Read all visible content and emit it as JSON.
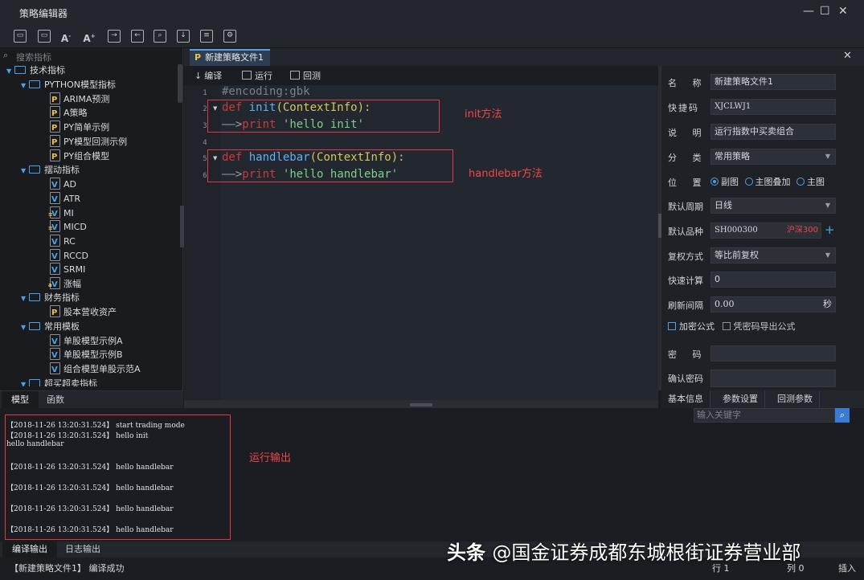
{
  "window": {
    "title": "策略编辑器",
    "minimize": "—",
    "maximize": "☐",
    "close": "✕"
  },
  "toolbar": {
    "font_decrease": "A",
    "font_increase": "A"
  },
  "left_panel": {
    "search_placeholder": "搜索指标",
    "tree": [
      {
        "label": "技术指标",
        "type": "folder"
      },
      {
        "label": "PYTHON模型指标",
        "type": "folder"
      },
      {
        "label": "ARIMA预测",
        "type": "py"
      },
      {
        "label": "A策略",
        "type": "py"
      },
      {
        "label": "PY简单示例",
        "type": "py"
      },
      {
        "label": "PY模型回测示例",
        "type": "py"
      },
      {
        "label": "PY组合模型",
        "type": "py"
      },
      {
        "label": "摆动指标",
        "type": "folder"
      },
      {
        "label": "AD",
        "type": "v"
      },
      {
        "label": "ATR",
        "type": "v"
      },
      {
        "label": "MI",
        "type": "v"
      },
      {
        "label": "MICD",
        "type": "v"
      },
      {
        "label": "RC",
        "type": "v"
      },
      {
        "label": "RCCD",
        "type": "v"
      },
      {
        "label": "SRMI",
        "type": "v"
      },
      {
        "label": "涨幅",
        "type": "v"
      },
      {
        "label": "财务指标",
        "type": "folder"
      },
      {
        "label": "股本营收资产",
        "type": "py"
      },
      {
        "label": "常用模板",
        "type": "folder"
      },
      {
        "label": "单股模型示例A",
        "type": "v"
      },
      {
        "label": "单股模型示例B",
        "type": "v"
      },
      {
        "label": "组合模型单股示范A",
        "type": "v"
      },
      {
        "label": "超买超卖指标",
        "type": "folder"
      }
    ],
    "tabs": [
      "模型",
      "函数"
    ]
  },
  "editor": {
    "file_tab": "新建策略文件1",
    "file_tab_icon": "P",
    "close": "✕",
    "actions": {
      "compile": "编译",
      "run": "运行",
      "backtest": "回测"
    },
    "line_numbers": [
      "1",
      "2",
      "3",
      "4",
      "5",
      "6"
    ],
    "code": {
      "l1": "#encoding:gbk",
      "l2_kw": "def",
      "l2_fn": "init",
      "l2_rest": "(ContextInfo):",
      "l3_arrow": "——>",
      "l3_kw": "print",
      "l3_str": "'hello init'",
      "l5_kw": "def",
      "l5_fn": "handlebar",
      "l5_rest": "(ContextInfo):",
      "l6_arrow": "——>",
      "l6_kw": "print",
      "l6_str": "'hello handlebar'"
    },
    "annotations": {
      "init": "init方法",
      "handlebar": "handlebar方法"
    }
  },
  "properties": {
    "name_label": "名 称",
    "name_value": "新建策略文件1",
    "shortcut_label": "快捷码",
    "shortcut_value": "XJCLWJ1",
    "desc_label": "说 明",
    "desc_value": "运行指数中买卖组合",
    "category_label": "分 类",
    "category_value": "常用策略",
    "position_label": "位 置",
    "position_options": [
      "副图",
      "主图叠加",
      "主图"
    ],
    "position_selected": "副图",
    "period_label": "默认周期",
    "period_value": "日线",
    "symbol_label": "默认品种",
    "symbol_value": "SH000300",
    "symbol_name": "沪深300",
    "symbol_add": "+",
    "adjust_label": "复权方式",
    "adjust_value": "等比前复权",
    "quick_calc_label": "快速计算",
    "quick_calc_value": "0",
    "refresh_label": "刷新间隔",
    "refresh_value": "0.00",
    "refresh_unit": "秒",
    "encrypt_label": "加密公式",
    "export_label": "凭密码导出公式",
    "password_label": "密 码",
    "confirm_password_label": "确认密码",
    "tabs": [
      "基本信息",
      "参数设置",
      "回测参数"
    ]
  },
  "output": {
    "search_placeholder": "输入关键字",
    "lines": [
      "【2018-11-26 13:20:31.524】 start trading mode",
      "【2018-11-26 13:20:31.524】 hello init",
      "hello handlebar",
      "【2018-11-26 13:20:31.524】 hello handlebar",
      "【2018-11-26 13:20:31.524】 hello handlebar",
      "【2018-11-26 13:20:31.524】 hello handlebar",
      "【2018-11-26 13:20:31.524】 hello handlebar"
    ],
    "annotation": "运行输出",
    "tabs": [
      "编译输出",
      "日志输出"
    ]
  },
  "status": {
    "message": "【新建策略文件1】 编译成功",
    "row": "行 1",
    "col": "列 0",
    "mode": "插入"
  },
  "watermark": {
    "brand": "头条",
    "account": "@国金证券成都东城根街证券营业部"
  },
  "colors": {
    "accent": "#4aa3e8",
    "keyword": "#cc3b3b",
    "string": "#7fd08a",
    "annotation": "#f04848",
    "background": "#1b1d22"
  }
}
